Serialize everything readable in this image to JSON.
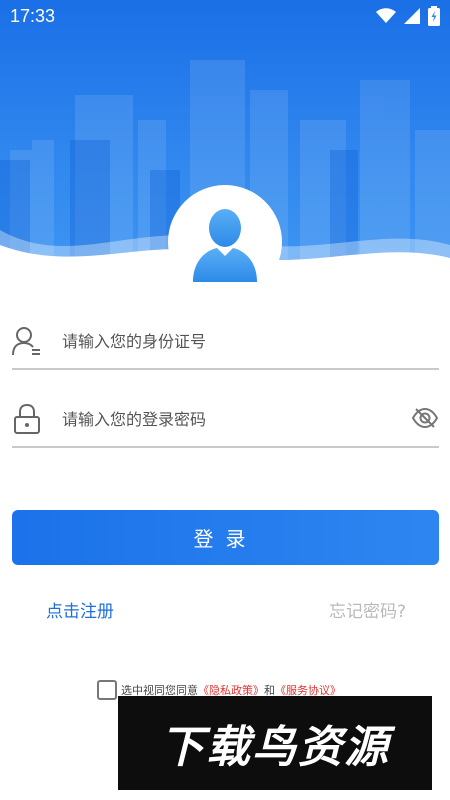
{
  "status_bar": {
    "time": "17:33",
    "icons": [
      "wifi-icon",
      "signal-icon",
      "battery-icon"
    ]
  },
  "colors": {
    "brand_blue": "#1b72ea",
    "link_blue": "#1f6fd9",
    "link_red": "#e03333",
    "muted_gray": "#b9b9b9"
  },
  "form": {
    "id_field": {
      "placeholder": "请输入您的身份证号",
      "value": "",
      "icon": "user-icon"
    },
    "password_field": {
      "placeholder": "请输入您的登录密码",
      "value": "",
      "icon": "lock-icon",
      "toggle_icon": "eye-off-icon"
    },
    "login_label": "登录"
  },
  "links": {
    "register": "点击注册",
    "forgot_password": "忘记密码?"
  },
  "agreement": {
    "checked": false,
    "prefix": "选中视同您同意",
    "privacy_policy": "《隐私政策》",
    "conjunction": "和",
    "service_agreement": "《服务协议》"
  },
  "watermark": {
    "text": "下载鸟资源"
  }
}
